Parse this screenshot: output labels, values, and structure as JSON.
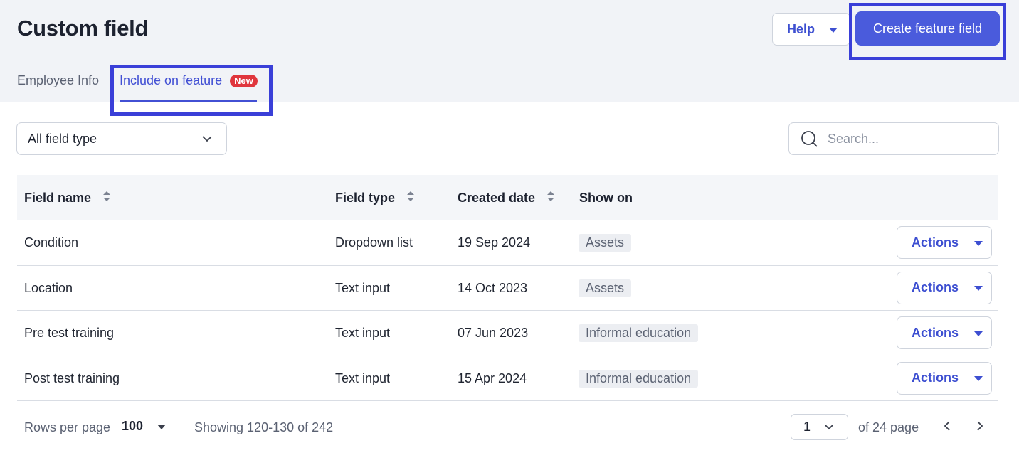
{
  "header": {
    "title": "Custom field",
    "help_label": "Help",
    "create_label": "Create feature field"
  },
  "tabs": [
    {
      "label": "Employee Info",
      "active": false
    },
    {
      "label": "Include on feature",
      "active": true,
      "badge": "New"
    }
  ],
  "filter": {
    "selected": "All field type"
  },
  "search": {
    "placeholder": "Search..."
  },
  "table": {
    "columns": [
      "Field name",
      "Field type",
      "Created date",
      "Show on"
    ],
    "rows": [
      {
        "name": "Condition",
        "type": "Dropdown list",
        "date": "19 Sep 2024",
        "show_on": "Assets",
        "action": "Actions"
      },
      {
        "name": "Location",
        "type": "Text input",
        "date": "14 Oct 2023",
        "show_on": "Assets",
        "action": "Actions"
      },
      {
        "name": "Pre test training",
        "type": "Text input",
        "date": "07 Jun 2023",
        "show_on": "Informal education",
        "action": "Actions"
      },
      {
        "name": "Post test training",
        "type": "Text input",
        "date": "15 Apr 2024",
        "show_on": "Informal education",
        "action": "Actions"
      }
    ]
  },
  "pagination": {
    "rows_label": "Rows per page",
    "rows_value": "100",
    "showing": "Showing 120-130 of 242",
    "page": "1",
    "of_pages": "of 24 page"
  },
  "colors": {
    "accent": "#4a5bdc",
    "highlight_border": "#3a3fd8",
    "badge": "#e0363d",
    "header_bg": "#f1f3f7"
  },
  "icons": [
    "caret-down-icon",
    "chevron-down-icon",
    "search-icon",
    "sort-icon",
    "chevron-left-icon",
    "chevron-right-icon"
  ]
}
